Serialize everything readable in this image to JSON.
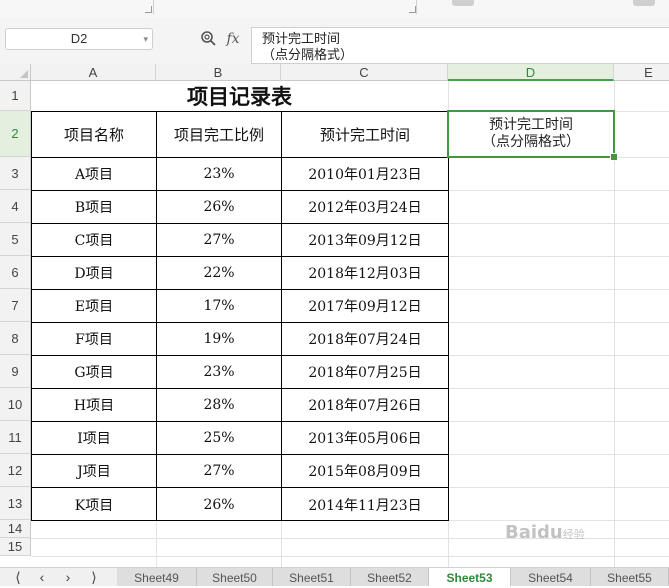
{
  "formula_bar": {
    "name_box": "D2",
    "fx_label": "fx",
    "content_line1": "预计完工时间",
    "content_line2": "（点分隔格式）"
  },
  "columns": [
    "A",
    "B",
    "C",
    "D",
    "E"
  ],
  "rows": [
    "1",
    "2",
    "3",
    "4",
    "5",
    "6",
    "7",
    "8",
    "9",
    "10",
    "11",
    "12",
    "13",
    "14",
    "15"
  ],
  "sheet": {
    "title": "项目记录表",
    "headers": [
      "项目名称",
      "项目完工比例",
      "预计完工时间"
    ],
    "d2_line1": "预计完工时间",
    "d2_line2": "（点分隔格式）",
    "records": [
      {
        "name": "A项目",
        "ratio": "23%",
        "date": "2010年01月23日"
      },
      {
        "name": "B项目",
        "ratio": "26%",
        "date": "2012年03月24日"
      },
      {
        "name": "C项目",
        "ratio": "27%",
        "date": "2013年09月12日"
      },
      {
        "name": "D项目",
        "ratio": "22%",
        "date": "2018年12月03日"
      },
      {
        "name": "E项目",
        "ratio": "17%",
        "date": "2017年09月12日"
      },
      {
        "name": "F项目",
        "ratio": "19%",
        "date": "2018年07月24日"
      },
      {
        "name": "G项目",
        "ratio": "23%",
        "date": "2018年07月25日"
      },
      {
        "name": "H项目",
        "ratio": "28%",
        "date": "2018年07月26日"
      },
      {
        "name": "I项目",
        "ratio": "25%",
        "date": "2013年05月06日"
      },
      {
        "name": "J项目",
        "ratio": "27%",
        "date": "2015年08月09日"
      },
      {
        "name": "K项目",
        "ratio": "26%",
        "date": "2014年11月23日"
      }
    ]
  },
  "sheet_tabs": [
    "Sheet49",
    "Sheet50",
    "Sheet51",
    "Sheet52",
    "Sheet53",
    "Sheet54",
    "Sheet55"
  ],
  "active_tab": "Sheet53",
  "nav_buttons": [
    "|<",
    "<",
    ">",
    ">|"
  ],
  "watermark": "Baidu经验",
  "colors": {
    "selection": "#3f9a3f",
    "active_tab_text": "#2e8b3a"
  }
}
